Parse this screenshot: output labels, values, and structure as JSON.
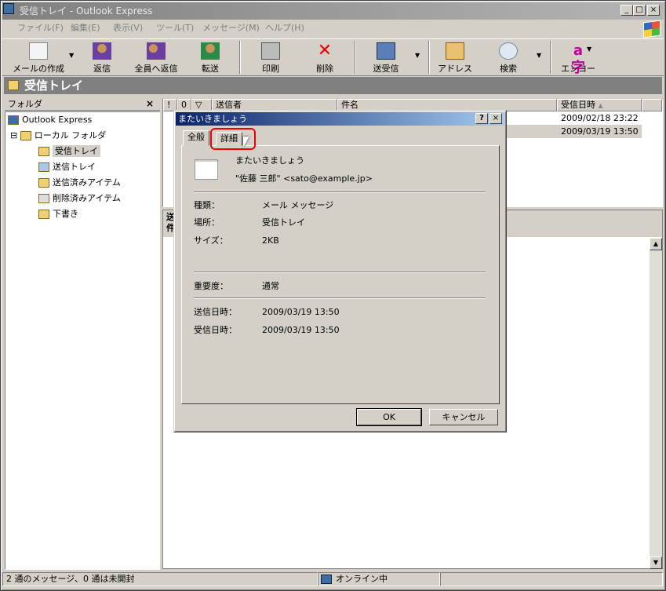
{
  "window": {
    "title": "受信トレイ - Outlook Express",
    "btn_min": "_",
    "btn_max": "□",
    "btn_close": "×"
  },
  "menu": [
    "ファイル(F)",
    "編集(E)",
    "表示(V)",
    "ツール(T)",
    "メッセージ(M)",
    "ヘルプ(H)"
  ],
  "toolbar": {
    "compose": "メールの作成",
    "reply": "返信",
    "reply_all": "全員へ返信",
    "forward": "転送",
    "print": "印刷",
    "delete": "削除",
    "send_receive": "送受信",
    "addresses": "アドレス",
    "find": "検索",
    "encode": "エンコード",
    "dropdown": "▼"
  },
  "header_title": "受信トレイ",
  "folders": {
    "title": "フォルダ",
    "close": "×",
    "items": [
      "Outlook Express",
      "ローカル フォルダ",
      "受信トレイ",
      "送信トレイ",
      "送信済みアイテム",
      "削除済みアイテム",
      "下書き"
    ],
    "expander": "⊟"
  },
  "columns": {
    "flag": "!",
    "attach": "0",
    "mark": "▽",
    "from": "送信者",
    "subject": "件名",
    "received": "受信日時",
    "sort": "▲"
  },
  "messages": [
    {
      "received": "2009/02/18 23:22"
    },
    {
      "received": "2009/03/19 13:50"
    }
  ],
  "preview": {
    "from_label": "送",
    "subject_label": "件"
  },
  "status": {
    "left": "2 通のメッセージ、0 通は未開封",
    "online": "オンライン中"
  },
  "dialog": {
    "title": "またいきましょう",
    "help": "?",
    "close": "×",
    "tabs": [
      "全般",
      "詳細"
    ],
    "subject": "またいきましょう",
    "sender": "\"佐藤 三郎\" <sato@example.jp>",
    "fields": [
      {
        "label": "種類：",
        "value": "メール メッセージ"
      },
      {
        "label": "場所：",
        "value": "受信トレイ"
      },
      {
        "label": "サイズ：",
        "value": "2KB"
      }
    ],
    "priority": {
      "label": "重要度：",
      "value": "通常"
    },
    "sent": {
      "label": "送信日時：",
      "value": "2009/03/19 13:50"
    },
    "received": {
      "label": "受信日時：",
      "value": "2009/03/19 13:50"
    },
    "ok": "OK",
    "cancel": "キャンセル"
  }
}
